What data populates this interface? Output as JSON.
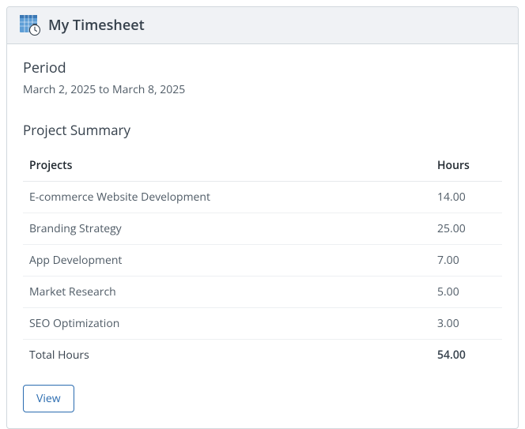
{
  "header": {
    "title": "My Timesheet"
  },
  "period": {
    "label": "Period",
    "range": "March 2, 2025 to March 8, 2025"
  },
  "summary": {
    "title": "Project Summary",
    "columns": {
      "projects": "Projects",
      "hours": "Hours"
    },
    "rows": [
      {
        "project": "E-commerce Website Development",
        "hours": "14.00"
      },
      {
        "project": "Branding Strategy",
        "hours": "25.00"
      },
      {
        "project": "App Development",
        "hours": "7.00"
      },
      {
        "project": "Market Research",
        "hours": "5.00"
      },
      {
        "project": "SEO Optimization",
        "hours": "3.00"
      }
    ],
    "total": {
      "label": "Total Hours",
      "hours": "54.00"
    }
  },
  "actions": {
    "view": "View"
  }
}
